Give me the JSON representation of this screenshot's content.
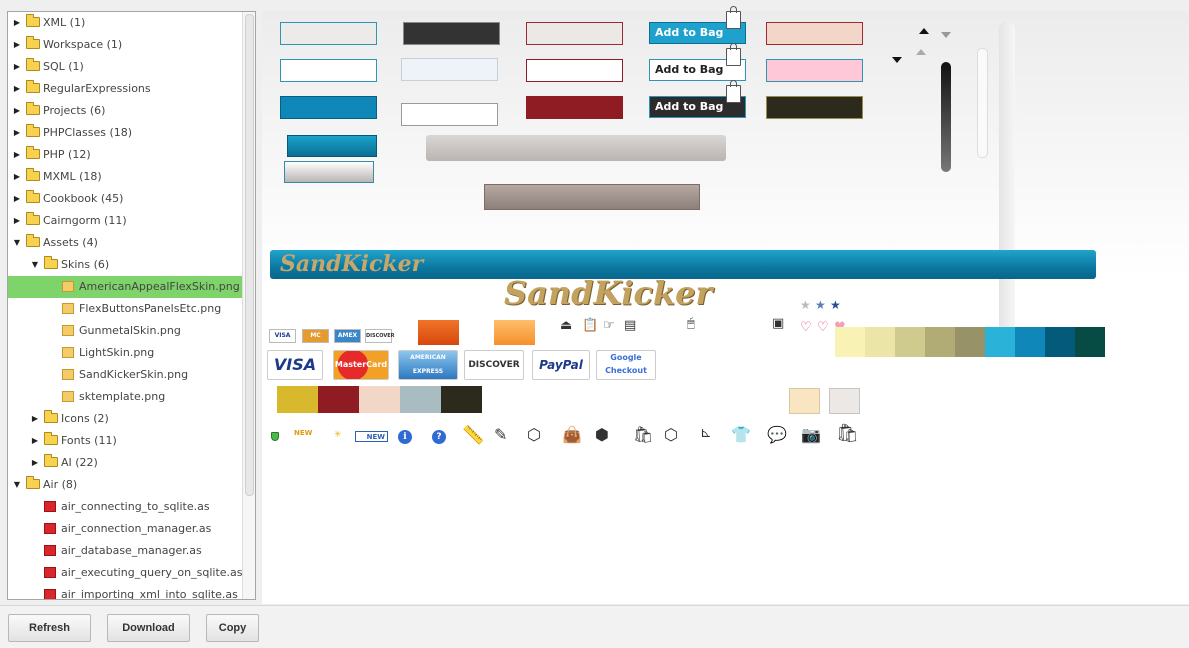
{
  "tree": {
    "items": [
      {
        "label": "XML (1)",
        "kind": "folder",
        "level": 0,
        "state": "collapsed"
      },
      {
        "label": "Workspace (1)",
        "kind": "folder",
        "level": 0,
        "state": "collapsed"
      },
      {
        "label": "SQL (1)",
        "kind": "folder",
        "level": 0,
        "state": "collapsed"
      },
      {
        "label": "RegularExpressions",
        "kind": "folder",
        "level": 0,
        "state": "collapsed"
      },
      {
        "label": "Projects (6)",
        "kind": "folder",
        "level": 0,
        "state": "collapsed"
      },
      {
        "label": "PHPClasses (18)",
        "kind": "folder",
        "level": 0,
        "state": "collapsed"
      },
      {
        "label": "PHP (12)",
        "kind": "folder",
        "level": 0,
        "state": "collapsed"
      },
      {
        "label": "MXML (18)",
        "kind": "folder",
        "level": 0,
        "state": "collapsed"
      },
      {
        "label": "Cookbook (45)",
        "kind": "folder",
        "level": 0,
        "state": "collapsed"
      },
      {
        "label": "Cairngorm (11)",
        "kind": "folder",
        "level": 0,
        "state": "collapsed"
      },
      {
        "label": "Assets (4)",
        "kind": "folder",
        "level": 0,
        "state": "expanded"
      },
      {
        "label": "Skins (6)",
        "kind": "folder",
        "level": 1,
        "state": "expanded"
      },
      {
        "label": "AmericanAppealFlexSkin.png",
        "kind": "png",
        "level": 2,
        "selected": true
      },
      {
        "label": "FlexButtonsPanelsEtc.png",
        "kind": "png",
        "level": 2
      },
      {
        "label": "GunmetalSkin.png",
        "kind": "png",
        "level": 2
      },
      {
        "label": "LightSkin.png",
        "kind": "png",
        "level": 2
      },
      {
        "label": "SandKickerSkin.png",
        "kind": "png",
        "level": 2
      },
      {
        "label": "sktemplate.png",
        "kind": "png",
        "level": 2
      },
      {
        "label": "Icons (2)",
        "kind": "folder",
        "level": 1,
        "state": "collapsed"
      },
      {
        "label": "Fonts (11)",
        "kind": "folder",
        "level": 1,
        "state": "collapsed"
      },
      {
        "label": "AI (22)",
        "kind": "folder",
        "level": 1,
        "state": "collapsed"
      },
      {
        "label": "Air (8)",
        "kind": "folder",
        "level": 0,
        "state": "expanded"
      },
      {
        "label": "air_connecting_to_sqlite.as",
        "kind": "as",
        "level": 1
      },
      {
        "label": "air_connection_manager.as",
        "kind": "as",
        "level": 1
      },
      {
        "label": "air_database_manager.as",
        "kind": "as",
        "level": 1
      },
      {
        "label": "air_executing_query_on_sqlite.as",
        "kind": "as",
        "level": 1
      },
      {
        "label": "air_importing_xml_into_sqlite.as",
        "kind": "as",
        "level": 1
      }
    ]
  },
  "preview": {
    "bag_buttons": [
      "Add to Bag",
      "Add to Bag",
      "Add to Bag"
    ],
    "logo_text": "SandKicker",
    "cards_small": [
      "VISA",
      "MC",
      "AMEX",
      "DISCOVER"
    ],
    "cards_large": [
      "VISA",
      "MasterCard",
      "AMERICAN EXPRESS",
      "DISCOVER",
      "PayPal",
      "Google Checkout"
    ],
    "badges": [
      "NEW",
      "NEW"
    ],
    "palette_right": [
      "#f8f2b4",
      "#ece5a8",
      "#cfca8e",
      "#b1ac76",
      "#979268",
      "#2bb2d9",
      "#0f88b9",
      "#045a7a",
      "#064c44"
    ],
    "palette_left": [
      "#d8b92e",
      "#8e1c22",
      "#f2d7c8",
      "#a9bcc1",
      "#2c2a1c"
    ],
    "accent": "#1391ba",
    "selection": "#7fd36b"
  },
  "buttons": {
    "refresh": "Refresh",
    "download": "Download",
    "copy": "Copy"
  }
}
